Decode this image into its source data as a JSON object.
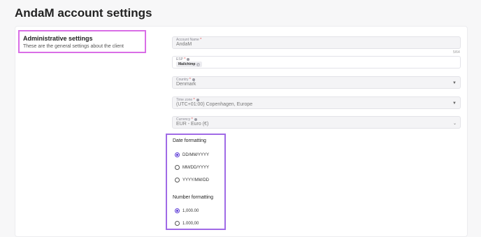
{
  "header": {
    "title": "AndaM account settings"
  },
  "admin": {
    "title": "Administrative settings",
    "description": "These are the general settings about the client"
  },
  "fields": {
    "account_name": {
      "label": "Account Name",
      "value": "AndaM",
      "counter": "5/64"
    },
    "esp": {
      "label": "ESP",
      "chip": "Mailchimp"
    },
    "country": {
      "label": "Country",
      "value": "Denmark"
    },
    "timezone": {
      "label": "Time zone",
      "value": "(UTC+01:00) Copenhagen, Europe"
    },
    "currency": {
      "label": "Currency",
      "value": "EUR - Euro (€)"
    }
  },
  "date_formatting": {
    "title": "Date formatting",
    "options": [
      "DD/MM/YYYY",
      "MM/DD/YYYY",
      "YYYY/MM/DD"
    ],
    "selected": "DD/MM/YYYY"
  },
  "number_formatting": {
    "title": "Number formatting",
    "options": [
      "1,000.00",
      "1.000,00"
    ],
    "selected": "1,000.00"
  },
  "colors": {
    "highlight_pink": "#d96ee6",
    "highlight_purple": "#a06ae6",
    "radio_accent": "#5b3ad6"
  }
}
